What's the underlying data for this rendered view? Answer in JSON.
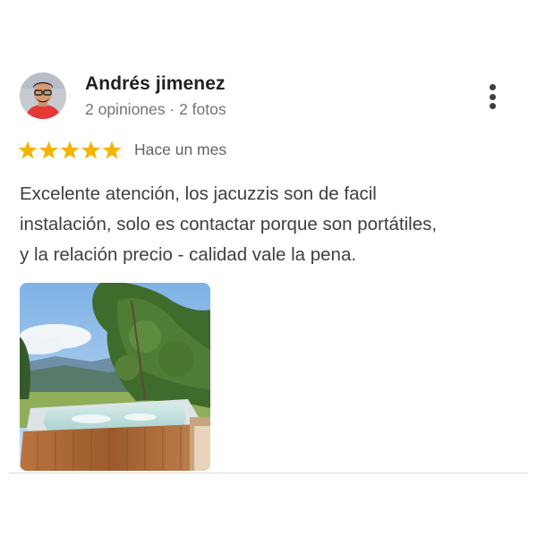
{
  "review": {
    "reviewer_name": "Andrés jimenez",
    "reviewer_meta": "2 opiniones · 2 fotos",
    "rating": 5,
    "rating_max": 5,
    "date": "Hace un mes",
    "text_lines": [
      "Excelente atención, los jacuzzis son de facil",
      "instalación, solo es contactar porque son portátiles,",
      "y la relación precio - calidad vale la pena."
    ]
  },
  "colors": {
    "star": "#f4b400",
    "name_text": "#202124",
    "meta_text": "#70757a",
    "body_text": "#3c4043",
    "divider": "#dadce0"
  },
  "icons": {
    "menu": "more-vert-icon",
    "star": "star-icon",
    "avatar": "avatar"
  }
}
